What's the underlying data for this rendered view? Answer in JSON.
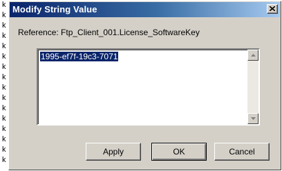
{
  "background_chars": [
    "k",
    "k",
    "k",
    "k",
    "k",
    "k",
    "k",
    "k",
    "k",
    "k",
    "k",
    "k",
    "k",
    "k",
    "k",
    "k"
  ],
  "dialog": {
    "title": "Modify String Value",
    "reference_text": "Reference: Ftp_Client_001.License_SoftwareKey",
    "value_text": "1995-ef7f-19c3-7071",
    "buttons": {
      "apply": "Apply",
      "ok": "OK",
      "cancel": "Cancel"
    }
  },
  "colors": {
    "title_start": "#0a246a",
    "title_end": "#a6caf0",
    "face": "#d4d0c8",
    "selection": "#0a246a"
  }
}
